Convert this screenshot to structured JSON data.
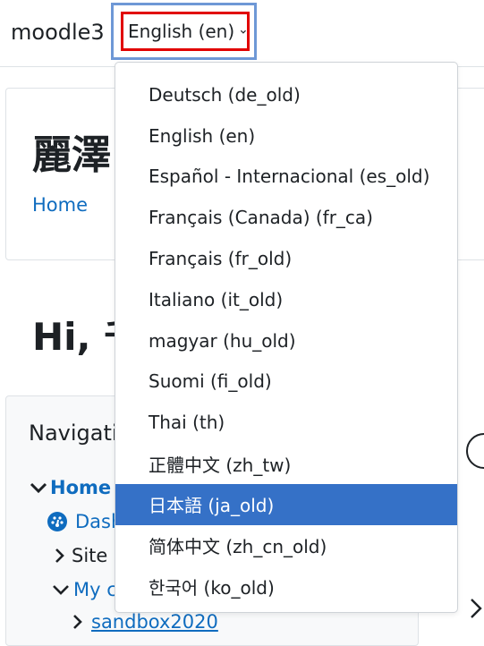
{
  "navbar": {
    "brand": "moodle3",
    "language_toggle": "English (en)",
    "language_toggle_icon": "chevron-down-icon"
  },
  "page": {
    "site_title": "麗澤",
    "breadcrumb_home": "Home",
    "greeting": "Hi, 千",
    "navigation_block": {
      "title": "Navigatio",
      "items": [
        {
          "label": "Home",
          "icon": "chevron-down-icon"
        },
        {
          "label": "Dash",
          "icon": "dashboard-icon"
        },
        {
          "label": "Site p",
          "icon": "chevron-right-icon"
        },
        {
          "label": "My c",
          "icon": "chevron-down-icon"
        },
        {
          "label": "sandbox2020",
          "icon": "chevron-right-icon"
        }
      ]
    }
  },
  "language_menu": {
    "selected_index": 11,
    "items": [
      "Deutsch (de_old)",
      "English (en)",
      "Español - Internacional (es_old)",
      "Français (Canada) (fr_ca)",
      "Français (fr_old)",
      "Italiano (it_old)",
      "magyar (hu_old)",
      "Suomi (fi_old)",
      "Thai (th)",
      "正體中文 (zh_tw)",
      "日本語 (ja_old)",
      "简体中文 (zh_cn_old)",
      "한국어 (ko_old)"
    ]
  },
  "colors": {
    "highlight": "#3571c7",
    "focus_outer": "#6e98d6",
    "focus_inner": "#e10000",
    "link": "#0f6cbf"
  }
}
